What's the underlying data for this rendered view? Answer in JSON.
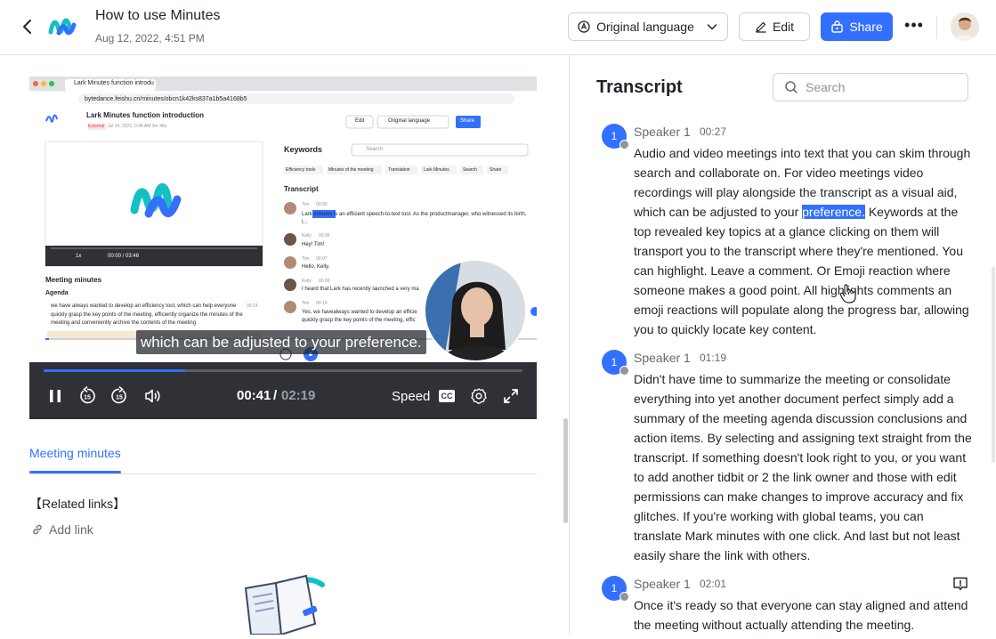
{
  "header": {
    "title": "How to use Minutes",
    "date": "Aug 12, 2022, 4:51 PM",
    "language_label": "Original language",
    "edit_label": "Edit",
    "share_label": "Share",
    "more_label": "•••"
  },
  "player": {
    "current_time": "00:41",
    "separator": "/",
    "total_time": "02:19",
    "progress": 0.295,
    "speed_label": "Speed",
    "cc_label": "CC",
    "skip_back_label": "15",
    "skip_forward_label": "15",
    "subtitle": "which can be adjusted to your preference."
  },
  "inner_screen": {
    "tab_title": "Lark Minutes function introdu",
    "url": "bytedance.feishu.cn/minutes/obcn1k42ks837a1b5a4168b5",
    "doc_title": "Lark Minutes function introduction",
    "doc_meta": "Jul 14, 2021, 0:46 AM  3m 48s",
    "external_badge": "External",
    "edit": "Edit",
    "original_language": "Original language",
    "share": "Share",
    "keywords_title": "Keywords",
    "search": "Search",
    "keywords": [
      "Efficiency tools",
      "Minutes of the meeting",
      "Translation",
      "Lark Minutes",
      "Search",
      "Share"
    ],
    "transcript_title": "Transcript",
    "meeting_minutes": "Meeting minutes",
    "agenda": "Agenda",
    "agenda_text": "we have always wanted to develop an efficiency tool, which can help everyone quickly grasp the key points of the meeting, efficiently organize the minutes of the meeting and conveniently archive the contents of the meeting",
    "agenda_time": "00:14",
    "player_speed": "1x",
    "player_time": "00:00 / 03:46",
    "entries": [
      {
        "name": "Tim",
        "time": "00:00",
        "text": "Lark minutes is an efficient speech-to-text tool. As the productmanager, who witnessed its birth, I..."
      },
      {
        "name": "Kelly",
        "time": "00:06",
        "text": "Hey! Tim!"
      },
      {
        "name": "Tim",
        "time": "00:07",
        "text": "Hello, Kelly."
      },
      {
        "name": "Kelly",
        "time": "00:09",
        "text": "I heard that Lark has recently launched a very ma"
      },
      {
        "name": "Tim",
        "time": "00:14",
        "text": "Yes, we havealways wanted to develop an efficie quickly grasp the key points of the meeting, effic"
      }
    ]
  },
  "left_tabs": {
    "active_tab": "Meeting minutes"
  },
  "related_links": {
    "title": "【Related links】",
    "add_link": "Add link"
  },
  "transcript": {
    "title": "Transcript",
    "search_placeholder": "Search",
    "segments": [
      {
        "avatar": "1",
        "speaker": "Speaker 1",
        "time": "00:27",
        "text_before": "Audio and video meetings into text that you can skim through search and collaborate on. For video meetings video recordings will play alongside the transcript as a visual aid, which can be adjusted to your ",
        "highlight": "preference.",
        "text_after": " Keywords at the top revealed key topics at a glance clicking on them will transport you to the transcript where they're mentioned. You can highlight. Leave a comment. Or Emoji reaction where someone makes a good point. All highlights comments an emoji reactions will populate along the progress bar, allowing you to quickly locate key content."
      },
      {
        "avatar": "1",
        "speaker": "Speaker 1",
        "time": "01:19",
        "text": "Didn't have time to summarize the meeting or consolidate everything into yet another document perfect simply add a summary of the meeting agenda discussion conclusions and action items. By selecting and assigning text straight from the transcript. If something doesn't look right to you, or you want to add another tidbit or 2 the link owner and those with edit permissions can make changes to improve accuracy and fix glitches. If you're working with global teams, you can translate Mark minutes with one click. And last but not least easily share the link with others."
      },
      {
        "avatar": "1",
        "speaker": "Speaker 1",
        "time": "02:01",
        "text": "Once it's ready so that everyone can stay aligned and attend the meeting without actually attending the meeting."
      }
    ]
  },
  "colors": {
    "accent": "#3370ff",
    "control_bar": "#2f3137",
    "text": "#1f2329",
    "muted": "#646a73"
  }
}
